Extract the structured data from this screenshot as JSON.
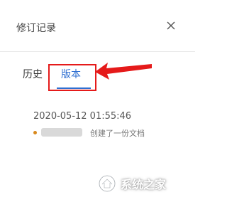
{
  "panel": {
    "title": "修订记录",
    "close_icon": "close-icon"
  },
  "tabs": [
    {
      "label": "历史",
      "active": false
    },
    {
      "label": "版本",
      "active": true
    }
  ],
  "records": [
    {
      "time": "2020-05-12 01:55:46",
      "action": "创建了一份文档",
      "status_color": "#d8891d"
    }
  ],
  "annotation": {
    "color": "#e51a1a"
  },
  "watermark": {
    "text": "系统之家",
    "icon": "house-logo-icon"
  },
  "accent_color": "#2f6fd1"
}
